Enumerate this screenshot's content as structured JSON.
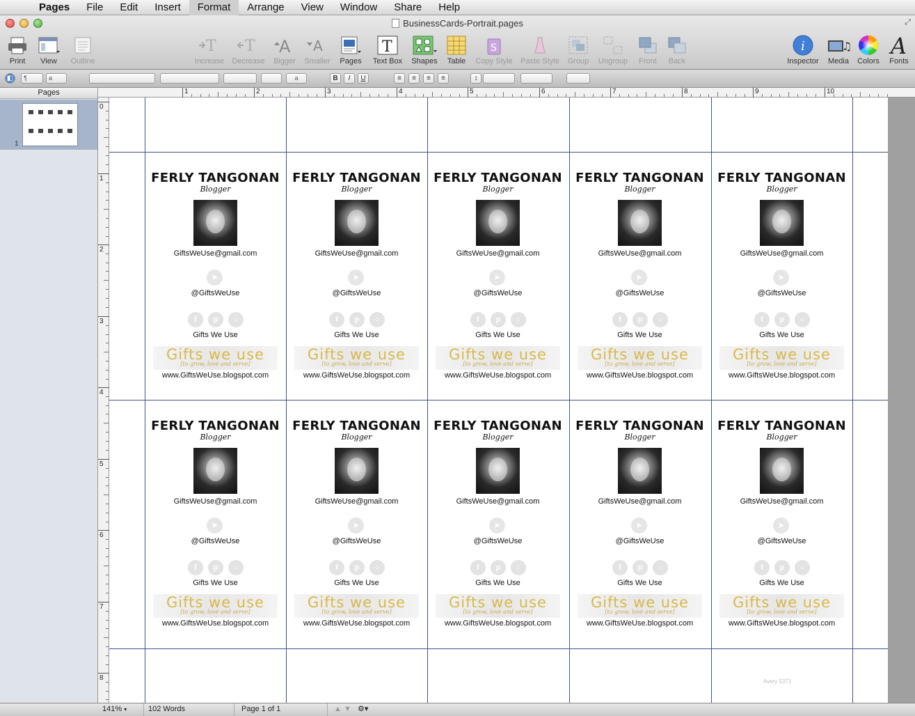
{
  "menubar": {
    "app": "Pages",
    "items": [
      "File",
      "Edit",
      "Insert",
      "Format",
      "Arrange",
      "View",
      "Window",
      "Share",
      "Help"
    ],
    "highlighted": "Format"
  },
  "window": {
    "title": "BusinessCards-Portrait.pages"
  },
  "toolbar": {
    "print": "Print",
    "view": "View",
    "outline": "Outline",
    "increase": "Increase",
    "decrease": "Decrease",
    "bigger": "Bigger",
    "smaller": "Smaller",
    "pages": "Pages",
    "textbox": "Text Box",
    "shapes": "Shapes",
    "table": "Table",
    "copystyle": "Copy Style",
    "pastestyle": "Paste Style",
    "group": "Group",
    "ungroup": "Ungroup",
    "front": "Front",
    "back": "Back",
    "inspector": "Inspector",
    "media": "Media",
    "colors": "Colors",
    "fonts": "Fonts"
  },
  "formatbar": {
    "para_style": "¶",
    "char_style": "a",
    "char_box": "a",
    "bold": "B",
    "italic": "I",
    "underline": "U"
  },
  "sidebar": {
    "header": "Pages",
    "page_number": "1"
  },
  "ruler": {
    "h_numbers": [
      "1",
      "2",
      "3",
      "4",
      "5",
      "6",
      "7",
      "8",
      "9",
      "10"
    ],
    "v_numbers": [
      "0",
      "1",
      "2",
      "3",
      "4",
      "5",
      "6",
      "7",
      "8"
    ]
  },
  "card": {
    "name": "FERLY TANGONAN",
    "role": "Blogger",
    "email": "GiftsWeUse@gmail.com",
    "twitter": "@GiftsWeUse",
    "social_name": "Gifts We Use",
    "social_icons": [
      "f",
      "p",
      "○"
    ],
    "logo_text": "Gifts we use",
    "logo_tagline": "[to grow, love and serve]",
    "website": "www.GiftsWeUse.blogspot.com"
  },
  "watermark": "Avery 5371",
  "status": {
    "zoom": "141%",
    "words": "102 Words",
    "page": "Page 1 of 1"
  },
  "colors": {
    "guide": "#3e5387",
    "logo_gold": "#d8b84a"
  }
}
